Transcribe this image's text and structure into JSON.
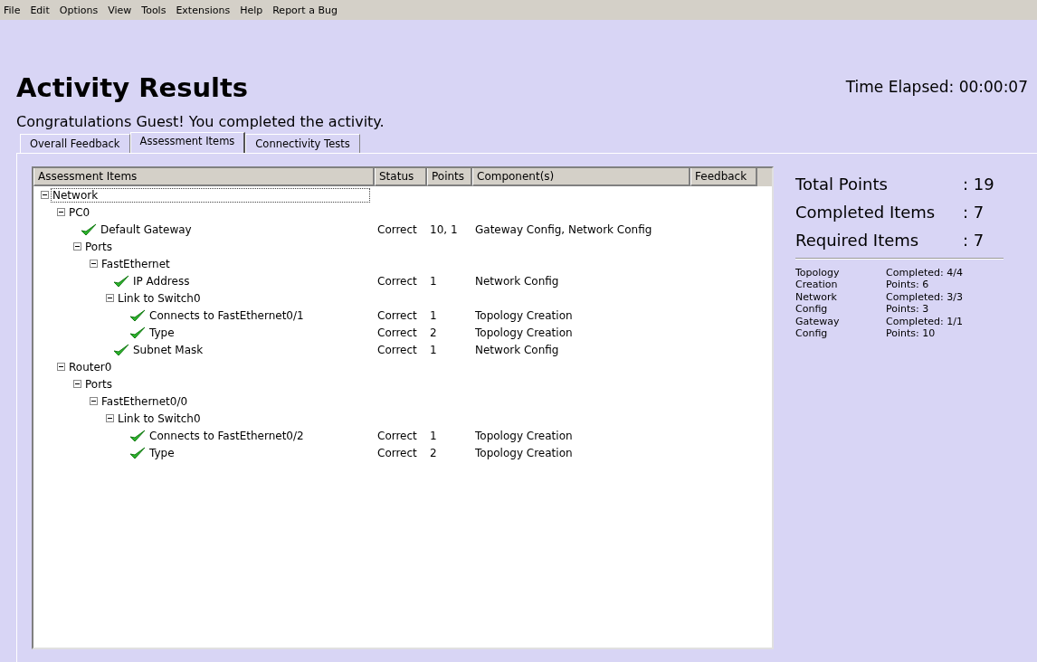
{
  "menu": [
    "File",
    "Edit",
    "Options",
    "View",
    "Tools",
    "Extensions",
    "Help",
    "Report a Bug"
  ],
  "title": "Activity Results",
  "time_elapsed": "Time Elapsed: 00:00:07",
  "message": "Congratulations Guest! You completed the activity.",
  "tabs": [
    {
      "label": "Overall Feedback",
      "selected": false
    },
    {
      "label": "Assessment Items",
      "selected": true
    },
    {
      "label": "Connectivity Tests",
      "selected": false
    }
  ],
  "table": {
    "columns": [
      "Assessment Items",
      "Status",
      "Points",
      "Component(s)",
      "Feedback"
    ],
    "tree": [
      {
        "label": "Network",
        "expanded": true,
        "focused": true,
        "children": [
          {
            "label": "PC0",
            "expanded": true,
            "children": [
              {
                "label": "Default Gateway",
                "passed": true,
                "status": "Correct",
                "points": "10, 1",
                "components": "Gateway Config, Network Config"
              },
              {
                "label": "Ports",
                "expanded": true,
                "children": [
                  {
                    "label": "FastEthernet",
                    "expanded": true,
                    "children": [
                      {
                        "label": "IP Address",
                        "passed": true,
                        "status": "Correct",
                        "points": "1",
                        "components": "Network Config"
                      },
                      {
                        "label": "Link to Switch0",
                        "expanded": true,
                        "children": [
                          {
                            "label": "Connects to FastEthernet0/1",
                            "passed": true,
                            "status": "Correct",
                            "points": "1",
                            "components": "Topology Creation"
                          },
                          {
                            "label": "Type",
                            "passed": true,
                            "status": "Correct",
                            "points": "2",
                            "components": "Topology Creation"
                          }
                        ]
                      },
                      {
                        "label": "Subnet Mask",
                        "passed": true,
                        "status": "Correct",
                        "points": "1",
                        "components": "Network Config"
                      }
                    ]
                  }
                ]
              }
            ]
          },
          {
            "label": "Router0",
            "expanded": true,
            "children": [
              {
                "label": "Ports",
                "expanded": true,
                "children": [
                  {
                    "label": "FastEthernet0/0",
                    "expanded": true,
                    "children": [
                      {
                        "label": "Link to Switch0",
                        "expanded": true,
                        "children": [
                          {
                            "label": "Connects to FastEthernet0/2",
                            "passed": true,
                            "status": "Correct",
                            "points": "1",
                            "components": "Topology Creation"
                          },
                          {
                            "label": "Type",
                            "passed": true,
                            "status": "Correct",
                            "points": "2",
                            "components": "Topology Creation"
                          }
                        ]
                      }
                    ]
                  }
                ]
              }
            ]
          }
        ]
      }
    ]
  },
  "summary": [
    {
      "label": "Total Points",
      "value": ": 19"
    },
    {
      "label": "Completed Items",
      "value": ": 7"
    },
    {
      "label": "Required Items",
      "value": ": 7"
    }
  ],
  "components": [
    {
      "name": "Topology Creation",
      "completed": "Completed: 4/4",
      "points": "Points: 6"
    },
    {
      "name": "Network Config",
      "completed": "Completed: 3/3",
      "points": "Points: 3"
    },
    {
      "name": "Gateway Config",
      "completed": "Completed: 1/1",
      "points": "Points: 10"
    }
  ]
}
